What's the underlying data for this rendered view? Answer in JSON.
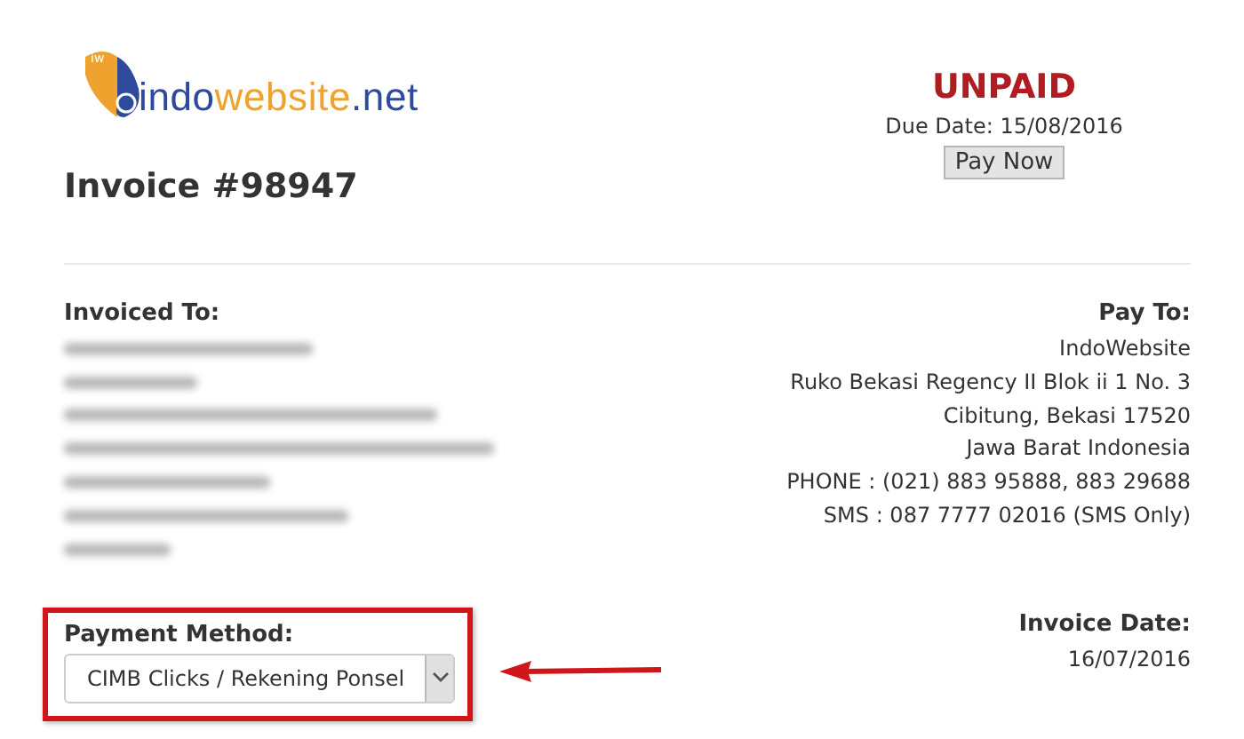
{
  "logo": {
    "badge": "iw",
    "parts": [
      {
        "text": "indo",
        "color": "#2f4a9c"
      },
      {
        "text": "website",
        "color": "#f0a22e"
      },
      {
        "text": ".net",
        "color": "#2f4a9c"
      }
    ]
  },
  "invoice": {
    "title": "Invoice #98947"
  },
  "status": {
    "label": "UNPAID",
    "due_date": "Due Date: 15/08/2016",
    "button": "Pay Now"
  },
  "invoiced_to": {
    "heading": "Invoiced To:"
  },
  "pay_to": {
    "heading": "Pay To:",
    "lines": [
      "IndoWebsite",
      "Ruko Bekasi Regency II Blok ii 1 No. 3",
      "Cibitung, Bekasi 17520",
      "Jawa Barat Indonesia",
      "PHONE : (021) 883 95888, 883 29688",
      "SMS : 087 7777 02016 (SMS Only)"
    ]
  },
  "payment_method": {
    "heading": "Payment Method:",
    "value": "CIMB Clicks / Rekening Ponsel"
  },
  "invoice_date": {
    "heading": "Invoice Date:",
    "value": "16/07/2016"
  }
}
